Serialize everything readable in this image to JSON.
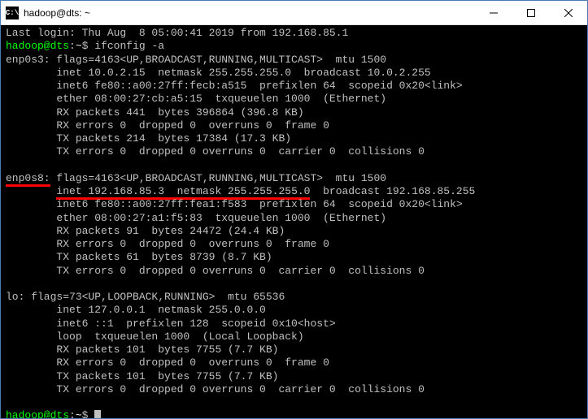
{
  "window": {
    "icon_text": "C:\\",
    "title": "hadoop@dts: ~"
  },
  "terminal": {
    "last_login": "Last login: Thu Aug  8 05:00:41 2019 from 192.168.85.1",
    "prompt_user": "hadoop@dts",
    "prompt_sep": ":",
    "prompt_path": "~",
    "prompt_symbol": "$",
    "command": "ifconfig -a",
    "iface1": {
      "name": "enp0s3:",
      "flags": " flags=4163<UP,BROADCAST,RUNNING,MULTICAST>  mtu 1500",
      "lines": [
        "        inet 10.0.2.15  netmask 255.255.255.0  broadcast 10.0.2.255",
        "        inet6 fe80::a00:27ff:fecb:a515  prefixlen 64  scopeid 0x20<link>",
        "        ether 08:00:27:cb:a5:15  txqueuelen 1000  (Ethernet)",
        "        RX packets 441  bytes 396864 (396.8 KB)",
        "        RX errors 0  dropped 0  overruns 0  frame 0",
        "        TX packets 214  bytes 17384 (17.3 KB)",
        "        TX errors 0  dropped 0 overruns 0  carrier 0  collisions 0"
      ]
    },
    "iface2": {
      "name": "enp0s8:",
      "flags": " flags=4163<UP,BROADCAST,RUNNING,MULTICAST>  mtu 1500",
      "inet_pre": "        ",
      "inet_highlight": "inet 192.168.85.3  netmask 255.255.255.0",
      "inet_post": "  broadcast 192.168.85.255",
      "lines": [
        "        inet6 fe80::a00:27ff:fea1:f583  prefixlen 64  scopeid 0x20<link>",
        "        ether 08:00:27:a1:f5:83  txqueuelen 1000  (Ethernet)",
        "        RX packets 91  bytes 24472 (24.4 KB)",
        "        RX errors 0  dropped 0  overruns 0  frame 0",
        "        TX packets 61  bytes 8739 (8.7 KB)",
        "        TX errors 0  dropped 0 overruns 0  carrier 0  collisions 0"
      ]
    },
    "iface3": {
      "name": "lo:",
      "flags": " flags=73<UP,LOOPBACK,RUNNING>  mtu 65536",
      "lines": [
        "        inet 127.0.0.1  netmask 255.0.0.0",
        "        inet6 ::1  prefixlen 128  scopeid 0x10<host>",
        "        loop  txqueuelen 1000  (Local Loopback)",
        "        RX packets 101  bytes 7755 (7.7 KB)",
        "        RX errors 0  dropped 0  overruns 0  frame 0",
        "        TX packets 101  bytes 7755 (7.7 KB)",
        "        TX errors 0  dropped 0 overruns 0  carrier 0  collisions 0"
      ]
    }
  }
}
